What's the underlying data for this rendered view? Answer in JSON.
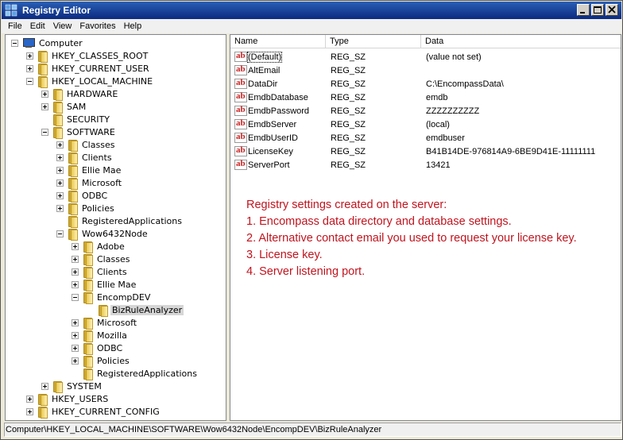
{
  "window": {
    "title": "Registry Editor"
  },
  "menubar": {
    "items": [
      "File",
      "Edit",
      "View",
      "Favorites",
      "Help"
    ]
  },
  "tree": [
    {
      "label": "Computer",
      "level": 0,
      "expander": "minus",
      "icon": "computer-icon"
    },
    {
      "label": "HKEY_CLASSES_ROOT",
      "level": 1,
      "expander": "plus",
      "icon": "folder-icon"
    },
    {
      "label": "HKEY_CURRENT_USER",
      "level": 1,
      "expander": "plus",
      "icon": "folder-icon"
    },
    {
      "label": "HKEY_LOCAL_MACHINE",
      "level": 1,
      "expander": "minus",
      "icon": "folder-icon"
    },
    {
      "label": "HARDWARE",
      "level": 2,
      "expander": "plus",
      "icon": "folder-icon"
    },
    {
      "label": "SAM",
      "level": 2,
      "expander": "plus",
      "icon": "folder-icon"
    },
    {
      "label": "SECURITY",
      "level": 2,
      "expander": "none",
      "icon": "folder-icon"
    },
    {
      "label": "SOFTWARE",
      "level": 2,
      "expander": "minus",
      "icon": "folder-icon"
    },
    {
      "label": "Classes",
      "level": 3,
      "expander": "plus",
      "icon": "folder-icon"
    },
    {
      "label": "Clients",
      "level": 3,
      "expander": "plus",
      "icon": "folder-icon"
    },
    {
      "label": "Ellie Mae",
      "level": 3,
      "expander": "plus",
      "icon": "folder-icon"
    },
    {
      "label": "Microsoft",
      "level": 3,
      "expander": "plus",
      "icon": "folder-icon"
    },
    {
      "label": "ODBC",
      "level": 3,
      "expander": "plus",
      "icon": "folder-icon"
    },
    {
      "label": "Policies",
      "level": 3,
      "expander": "plus",
      "icon": "folder-icon"
    },
    {
      "label": "RegisteredApplications",
      "level": 3,
      "expander": "none",
      "icon": "folder-icon"
    },
    {
      "label": "Wow6432Node",
      "level": 3,
      "expander": "minus",
      "icon": "folder-icon"
    },
    {
      "label": "Adobe",
      "level": 4,
      "expander": "plus",
      "icon": "folder-icon"
    },
    {
      "label": "Classes",
      "level": 4,
      "expander": "plus",
      "icon": "folder-icon"
    },
    {
      "label": "Clients",
      "level": 4,
      "expander": "plus",
      "icon": "folder-icon"
    },
    {
      "label": "Ellie Mae",
      "level": 4,
      "expander": "plus",
      "icon": "folder-icon"
    },
    {
      "label": "EncompDEV",
      "level": 4,
      "expander": "minus",
      "icon": "folder-icon"
    },
    {
      "label": "BizRuleAnalyzer",
      "level": 5,
      "expander": "none",
      "icon": "folder-icon",
      "selected": true
    },
    {
      "label": "Microsoft",
      "level": 4,
      "expander": "plus",
      "icon": "folder-icon"
    },
    {
      "label": "Mozilla",
      "level": 4,
      "expander": "plus",
      "icon": "folder-icon"
    },
    {
      "label": "ODBC",
      "level": 4,
      "expander": "plus",
      "icon": "folder-icon"
    },
    {
      "label": "Policies",
      "level": 4,
      "expander": "plus",
      "icon": "folder-icon"
    },
    {
      "label": "RegisteredApplications",
      "level": 4,
      "expander": "none",
      "icon": "folder-icon"
    },
    {
      "label": "SYSTEM",
      "level": 2,
      "expander": "plus",
      "icon": "folder-icon"
    },
    {
      "label": "HKEY_USERS",
      "level": 1,
      "expander": "plus",
      "icon": "folder-icon"
    },
    {
      "label": "HKEY_CURRENT_CONFIG",
      "level": 1,
      "expander": "plus",
      "icon": "folder-icon"
    }
  ],
  "list": {
    "columns": [
      "Name",
      "Type",
      "Data"
    ],
    "rows": [
      {
        "name": "(Default)",
        "type": "REG_SZ",
        "data": "(value not set)",
        "focused": true
      },
      {
        "name": "AltEmail",
        "type": "REG_SZ",
        "data": ""
      },
      {
        "name": "DataDir",
        "type": "REG_SZ",
        "data": "C:\\EncompassData\\"
      },
      {
        "name": "EmdbDatabase",
        "type": "REG_SZ",
        "data": "emdb"
      },
      {
        "name": "EmdbPassword",
        "type": "REG_SZ",
        "data": "ZZZZZZZZZZ"
      },
      {
        "name": "EmdbServer",
        "type": "REG_SZ",
        "data": "(local)"
      },
      {
        "name": "EmdbUserID",
        "type": "REG_SZ",
        "data": "emdbuser"
      },
      {
        "name": "LicenseKey",
        "type": "REG_SZ",
        "data": "B41B14DE-976814A9-6BE9D41E-11111111"
      },
      {
        "name": "ServerPort",
        "type": "REG_SZ",
        "data": "13421"
      }
    ],
    "value_icon": {
      "name": "string-value-icon",
      "glyph": "ab"
    }
  },
  "annotation": [
    "Registry settings created on the server:",
    "1. Encompass data directory and database settings.",
    "2. Alternative contact email you used to request your license key.",
    "3. License key.",
    "4. Server listening port."
  ],
  "statusbar": {
    "path": "Computer\\HKEY_LOCAL_MACHINE\\SOFTWARE\\Wow6432Node\\EncompDEV\\BizRuleAnalyzer"
  },
  "colors": {
    "title_bar": "#0a2a80",
    "annotation": "#c0141e",
    "selection": "#d6d6d6"
  }
}
